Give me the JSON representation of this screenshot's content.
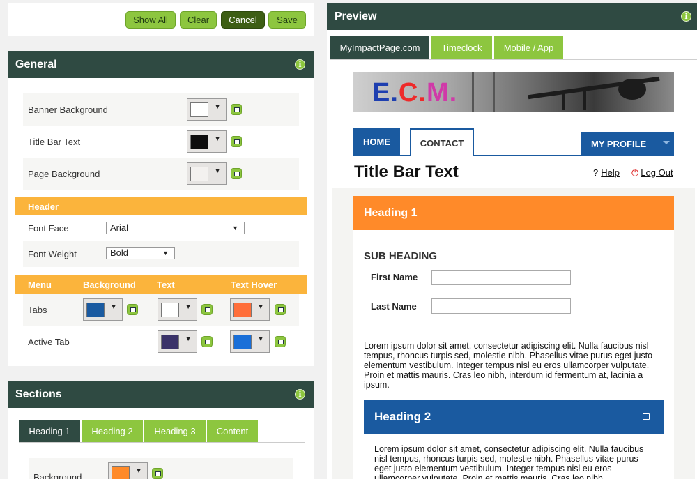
{
  "toolbar": {
    "show_all": "Show All",
    "clear": "Clear",
    "cancel": "Cancel",
    "save": "Save"
  },
  "general": {
    "title": "General",
    "rows": [
      {
        "label": "Banner Background",
        "color": "#ffffff"
      },
      {
        "label": "Title Bar Text",
        "color": "#0d0d0d"
      },
      {
        "label": "Page Background",
        "color": "#f3f1ef"
      }
    ],
    "header_section": {
      "title": "Header"
    },
    "font_face": {
      "label": "Font Face",
      "value": "Arial"
    },
    "font_weight": {
      "label": "Font Weight",
      "value": "Bold"
    },
    "menu_section": {
      "col_menu": "Menu",
      "col_background": "Background",
      "col_text": "Text",
      "col_text_hover": "Text Hover"
    },
    "tabs_row": {
      "label": "Tabs",
      "background": "#1a5aa0",
      "text": "#ffffff",
      "text_hover": "#ff6e3a"
    },
    "active_tab_row": {
      "label": "Active Tab",
      "text": "#3a3268",
      "text_hover": "#1a6fd8"
    }
  },
  "sections": {
    "title": "Sections",
    "tabs": [
      "Heading 1",
      "Heading 2",
      "Heading 3",
      "Content"
    ],
    "background": {
      "label": "Background",
      "color": "#ff8a29"
    }
  },
  "preview": {
    "title": "Preview",
    "tabs": [
      "MyImpactPage.com",
      "Timeclock",
      "Mobile / App"
    ],
    "logo": {
      "E": "E",
      "dot1": ".",
      "C": "C",
      "dot2": ".",
      "M": "M",
      "dot3": "."
    },
    "nav": {
      "home": "HOME",
      "contact": "CONTACT",
      "my_profile": "MY PROFILE"
    },
    "title_bar_text": "Title Bar Text",
    "help": "Help",
    "help_icon": "?",
    "logout": "Log Out",
    "heading1": "Heading 1",
    "sub_heading": "SUB HEADING",
    "first_name": "First Name",
    "last_name": "Last Name",
    "para1": "Lorem ipsum dolor sit amet, consectetur adipiscing elit. Nulla faucibus nisl tempus, rhoncus turpis sed, molestie nibh. Phasellus vitae purus eget justo elementum vestibulum. Integer tempus nisl eu eros ullamcorper vulputate. Proin et mattis mauris. Cras leo nibh, interdum id fermentum at, lacinia a ipsum.",
    "heading2": "Heading 2",
    "para2": "Lorem ipsum dolor sit amet, consectetur adipiscing elit. Nulla faucibus nisl tempus, rhoncus turpis sed, molestie nibh. Phasellus vitae purus eget justo elementum vestibulum. Integer tempus nisl eu eros ullamcorper vulputate. Proin et mattis mauris. Cras leo nibh,"
  },
  "colors": {
    "accent_green": "#8dc63f",
    "dark_header": "#2f4a42",
    "orange_bar": "#fbb43c",
    "heading1_bg": "#ff8a29",
    "heading2_bg": "#1a5aa0"
  },
  "icons": [
    "info-icon",
    "image-picker-icon",
    "dropdown-caret-icon",
    "print-icon",
    "power-icon",
    "help-icon"
  ]
}
